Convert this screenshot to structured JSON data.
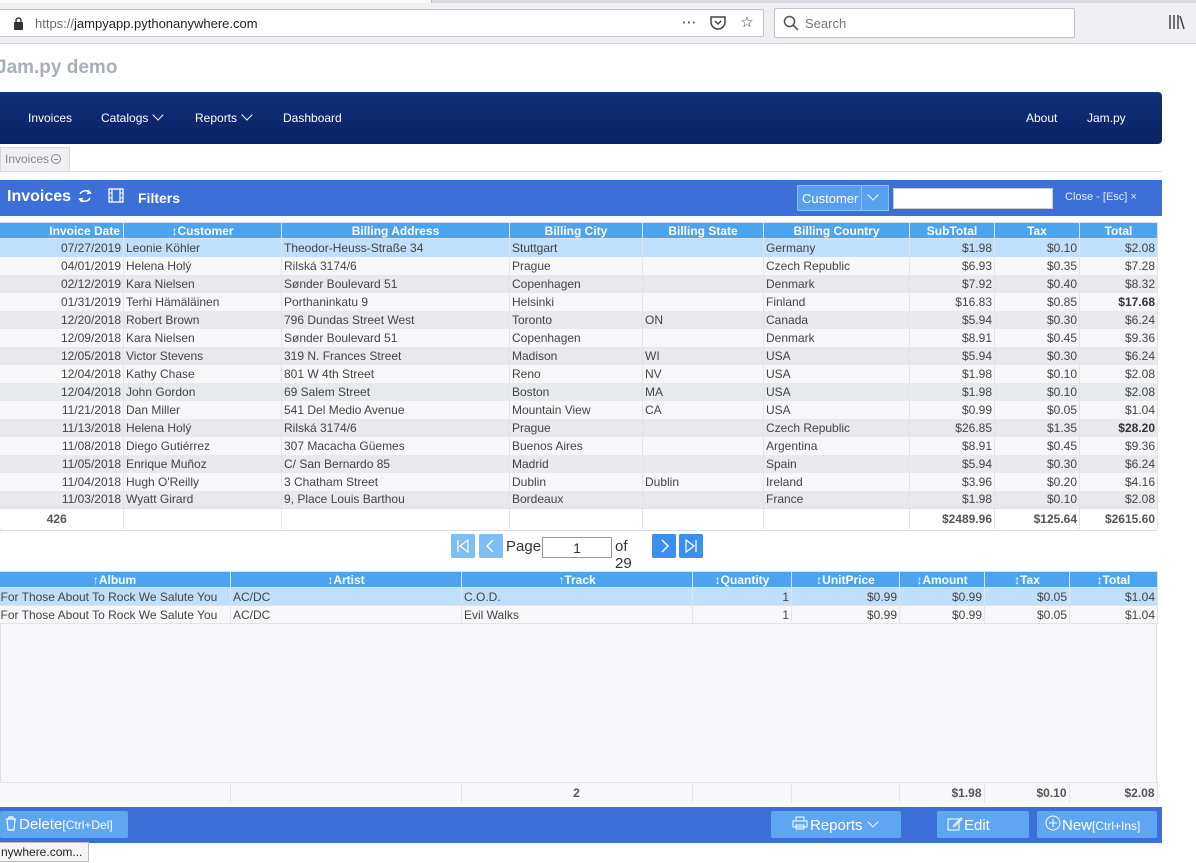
{
  "browser": {
    "url_protocol": "https://",
    "url_domain": "jampyapp.pythonanywhere.com",
    "search_placeholder": "Search"
  },
  "app": {
    "title": "Jam.py demo"
  },
  "nav": {
    "invoices": "Invoices",
    "catalogs": "Catalogs",
    "reports": "Reports",
    "dashboard": "Dashboard",
    "about": "About",
    "jampy": "Jam.py"
  },
  "tab": {
    "label": "Invoices"
  },
  "invoice_panel": {
    "title": "Invoices",
    "filters": "Filters",
    "search_field": "Customer",
    "close": "Close - [Esc] ×"
  },
  "invoices_table": {
    "columns": [
      "Invoice Date",
      "↕Customer",
      "Billing Address",
      "Billing City",
      "Billing State",
      "Billing Country",
      "SubTotal",
      "Tax",
      "Total"
    ],
    "rows": [
      [
        "07/27/2019",
        "Leonie Köhler",
        "Theodor-Heuss-Straße 34",
        "Stuttgart",
        "",
        "Germany",
        "$1.98",
        "$0.10",
        "$2.08"
      ],
      [
        "04/01/2019",
        "Helena Holý",
        "Rilská 3174/6",
        "Prague",
        "",
        "Czech Republic",
        "$6.93",
        "$0.35",
        "$7.28"
      ],
      [
        "02/12/2019",
        "Kara Nielsen",
        "Sønder Boulevard 51",
        "Copenhagen",
        "",
        "Denmark",
        "$7.92",
        "$0.40",
        "$8.32"
      ],
      [
        "01/31/2019",
        "Terhi Hämäläinen",
        "Porthaninkatu 9",
        "Helsinki",
        "",
        "Finland",
        "$16.83",
        "$0.85",
        "$17.68"
      ],
      [
        "12/20/2018",
        "Robert Brown",
        "796 Dundas Street West",
        "Toronto",
        "ON",
        "Canada",
        "$5.94",
        "$0.30",
        "$6.24"
      ],
      [
        "12/09/2018",
        "Kara Nielsen",
        "Sønder Boulevard 51",
        "Copenhagen",
        "",
        "Denmark",
        "$8.91",
        "$0.45",
        "$9.36"
      ],
      [
        "12/05/2018",
        "Victor Stevens",
        "319 N. Frances Street",
        "Madison",
        "WI",
        "USA",
        "$5.94",
        "$0.30",
        "$6.24"
      ],
      [
        "12/04/2018",
        "Kathy Chase",
        "801 W 4th Street",
        "Reno",
        "NV",
        "USA",
        "$1.98",
        "$0.10",
        "$2.08"
      ],
      [
        "12/04/2018",
        "John Gordon",
        "69 Salem Street",
        "Boston",
        "MA",
        "USA",
        "$1.98",
        "$0.10",
        "$2.08"
      ],
      [
        "11/21/2018",
        "Dan Miller",
        "541 Del Medio Avenue",
        "Mountain View",
        "CA",
        "USA",
        "$0.99",
        "$0.05",
        "$1.04"
      ],
      [
        "11/13/2018",
        "Helena Holý",
        "Rilská 3174/6",
        "Prague",
        "",
        "Czech Republic",
        "$26.85",
        "$1.35",
        "$28.20"
      ],
      [
        "11/08/2018",
        "Diego Gutiérrez",
        "307 Macacha Güemes",
        "Buenos Aires",
        "",
        "Argentina",
        "$8.91",
        "$0.45",
        "$9.36"
      ],
      [
        "11/05/2018",
        "Enrique Muñoz",
        "C/ San Bernardo 85",
        "Madrid",
        "",
        "Spain",
        "$5.94",
        "$0.30",
        "$6.24"
      ],
      [
        "11/04/2018",
        "Hugh O'Reilly",
        "3 Chatham Street",
        "Dublin",
        "Dublin",
        "Ireland",
        "$3.96",
        "$0.20",
        "$4.16"
      ],
      [
        "11/03/2018",
        "Wyatt Girard",
        "9, Place Louis Barthou",
        "Bordeaux",
        "",
        "France",
        "$1.98",
        "$0.10",
        "$2.08"
      ]
    ],
    "bold_totals": [
      "$17.68",
      "$28.20"
    ],
    "footer": [
      "426",
      "",
      "",
      "",
      "",
      "",
      "$2489.96",
      "$125.64",
      "$2615.60"
    ]
  },
  "pager": {
    "page_label": "Page",
    "current": "1",
    "of_label": "of 29"
  },
  "items_table": {
    "columns": [
      "↑Album",
      "↕Artist",
      "↑Track",
      "↕Quantity",
      "↕UnitPrice",
      "↕Amount",
      "↕Tax",
      "↕Total"
    ],
    "rows": [
      [
        "For Those About To Rock We Salute You",
        "AC/DC",
        "C.O.D.",
        "1",
        "$0.99",
        "$0.99",
        "$0.05",
        "$1.04"
      ],
      [
        "For Those About To Rock We Salute You",
        "AC/DC",
        "Evil Walks",
        "1",
        "$0.99",
        "$0.99",
        "$0.05",
        "$1.04"
      ]
    ],
    "footer": [
      "",
      "",
      "2",
      "",
      "",
      "$1.98",
      "$0.10",
      "$2.08"
    ]
  },
  "bottom": {
    "delete": "Delete",
    "delete_shortcut": "[Ctrl+Del]",
    "reports": "Reports",
    "edit": "Edit",
    "new": "New",
    "new_shortcut": "[Ctrl+Ins]"
  },
  "status": {
    "link": "nywhere.com..."
  },
  "colors": {
    "navbar": "#0b2265",
    "panel_bar": "#3c6fd8",
    "header_cell": "#4ba4f0",
    "selected_row": "#bfdffb"
  }
}
